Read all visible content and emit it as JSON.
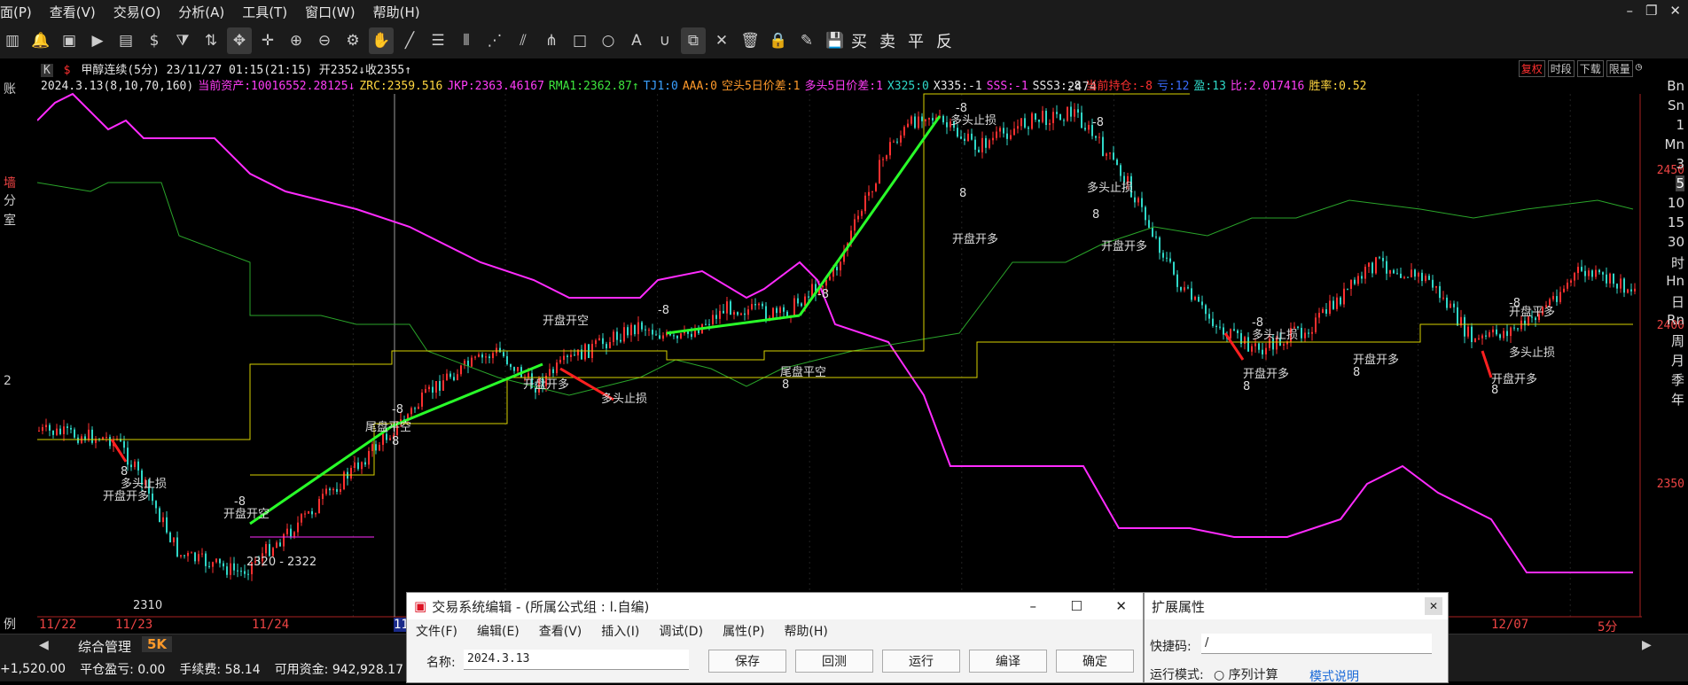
{
  "menu": {
    "items": [
      "面(P)",
      "查看(V)",
      "交易(O)",
      "分析(A)",
      "工具(T)",
      "窗口(W)",
      "帮助(H)"
    ]
  },
  "toolbar": {
    "trade_labels": [
      "买",
      "卖",
      "平",
      "反"
    ]
  },
  "chart_header": {
    "line1": "甲醇连续(5分) 23/11/27 01:15(21:15) 开2352↓收2355↑",
    "line2": [
      {
        "text": "2024.3.13(8,10,70,160)",
        "color": "#e6e6e6"
      },
      {
        "text": "当前资产:10016552.28125↓",
        "color": "#ff3df7"
      },
      {
        "text": "ZRC:2359.516",
        "color": "#ffd640"
      },
      {
        "text": "JKP:2363.46167",
        "color": "#ff3df7"
      },
      {
        "text": "RMA1:2362.87↑",
        "color": "#3ee63e"
      },
      {
        "text": "TJ1:0",
        "color": "#3aa0ff"
      },
      {
        "text": "AAA:0",
        "color": "#ff9a2a"
      },
      {
        "text": "空头5日价差:1",
        "color": "#ff9a2a"
      },
      {
        "text": "多头5日价差:1",
        "color": "#ff3df7"
      },
      {
        "text": "X325:0",
        "color": "#2fd8c8"
      },
      {
        "text": "X335:-1",
        "color": "#e6e6e6"
      },
      {
        "text": "SSS:-1",
        "color": "#ff3df7"
      },
      {
        "text": "SSS3:-8",
        "color": "#e6e6e6"
      },
      {
        "text": "当前持仓:-8",
        "color": "#ff3030"
      },
      {
        "text": "亏:12",
        "color": "#3a6cff"
      },
      {
        "text": "盈:13",
        "color": "#2fd8c8"
      },
      {
        "text": "比:2.017416",
        "color": "#ff3df7"
      },
      {
        "text": "胜率:0.52",
        "color": "#ffd640"
      }
    ],
    "badges": [
      "复权",
      "时段",
      "下载",
      "限量"
    ]
  },
  "price_axis": {
    "labels": [
      "2450",
      "2400",
      "2350"
    ]
  },
  "period_buttons": [
    "Bn",
    "Sn",
    "1",
    "Mn",
    "3",
    "5",
    "10",
    "15",
    "30",
    "时",
    "Hn",
    "日",
    "Rn",
    "周",
    "月",
    "季",
    "年"
  ],
  "period_selected": "5",
  "x_axis": {
    "labels": [
      "11/22",
      "11/23",
      "11/24",
      "11/",
      "12/07",
      "5分"
    ]
  },
  "annotations": [
    {
      "text": "2474"
    },
    {
      "text": "2320 - 2322"
    },
    {
      "text": "2310"
    },
    {
      "text": "多头止损"
    },
    {
      "text": "开盘开多"
    },
    {
      "text": "开盘开空"
    },
    {
      "text": "尾盘平空"
    },
    {
      "text": "尾盘平多"
    },
    {
      "text": "开盘平多"
    },
    {
      "text": "-8"
    },
    {
      "text": "8"
    }
  ],
  "bottom_tabs": {
    "nav_label": "综合管理",
    "active_tab": "5K"
  },
  "statusbar": {
    "items": [
      "+1,520.00",
      "平仓盈亏: 0.00",
      "手续费: 58.14",
      "可用资金: 942,928.17"
    ]
  },
  "dialog": {
    "title": "交易系统编辑 - (所属公式组 : l.自编)",
    "menu": [
      "文件(F)",
      "编辑(E)",
      "查看(V)",
      "插入(I)",
      "调试(D)",
      "属性(P)",
      "帮助(H)"
    ],
    "name_label": "名称:",
    "name_value": "2024.3.13",
    "buttons": [
      "保存",
      "回测",
      "运行",
      "编译",
      "确定"
    ]
  },
  "dialog2": {
    "title": "扩展属性",
    "shortcut_label": "快捷码:",
    "shortcut_value": "/",
    "mode_label": "运行模式:",
    "mode_option": "序列计算",
    "mode_help": "模式说明"
  },
  "left_strip": {
    "labels": [
      "账",
      "墙",
      "分",
      "室",
      "2",
      "例"
    ]
  },
  "colors": {
    "up": "#ff3030",
    "down": "#2fd8c8",
    "magenta": "#ff2bff",
    "green_signal": "#29ff29",
    "red_signal": "#ff2020",
    "olive": "#2aa52a",
    "yellow": "#d7d200"
  }
}
